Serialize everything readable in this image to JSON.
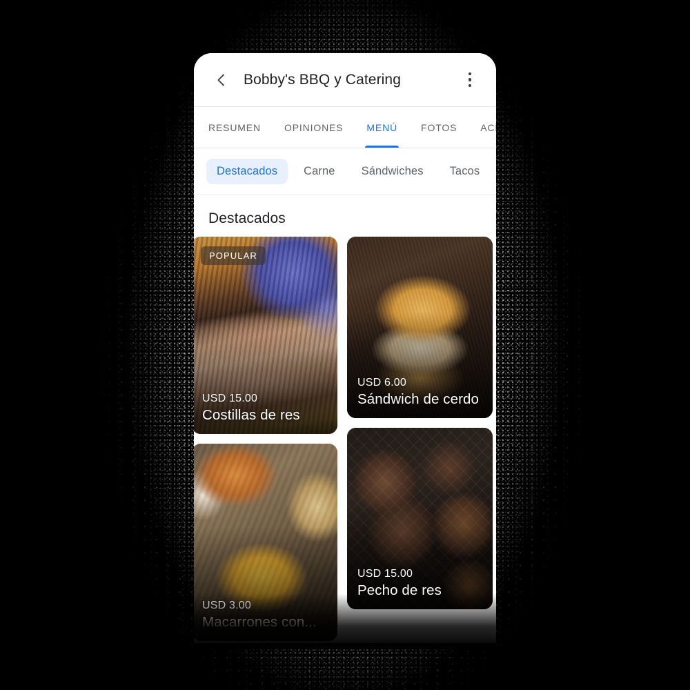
{
  "appbar": {
    "back_icon": "chevron-left-icon",
    "title": "Bobby's BBQ y Catering",
    "overflow_icon": "more-vert-icon"
  },
  "tabs": [
    {
      "label": "RESUMEN",
      "active": false
    },
    {
      "label": "OPINIONES",
      "active": false
    },
    {
      "label": "MENÚ",
      "active": true
    },
    {
      "label": "FOTOS",
      "active": false
    },
    {
      "label": "ACERC",
      "active": false
    }
  ],
  "chips": [
    {
      "label": "Destacados",
      "selected": true
    },
    {
      "label": "Carne",
      "selected": false
    },
    {
      "label": "Sándwiches",
      "selected": false
    },
    {
      "label": "Tacos",
      "selected": false
    }
  ],
  "section": {
    "title": "Destacados"
  },
  "items": [
    {
      "badge": "POPULAR",
      "price": "USD 15.00",
      "name": "Costillas de res",
      "image": "beef-ribs-photo"
    },
    {
      "badge": "",
      "price": "USD 6.00",
      "name": "Sándwich de cerdo",
      "image": "pork-sandwich-photo"
    },
    {
      "badge": "",
      "price": "USD 3.00",
      "name": "Macarrones con...",
      "image": "mac-and-cheese-photo"
    },
    {
      "badge": "",
      "price": "USD 15.00",
      "name": "Pecho de res",
      "image": "brisket-photo"
    }
  ],
  "colors": {
    "accent": "#1a73e8",
    "chip_selected_bg": "#e8f0fe",
    "text_primary": "#202124",
    "text_secondary": "#5f6368",
    "surface": "#ffffff",
    "backdrop": "#000000"
  }
}
